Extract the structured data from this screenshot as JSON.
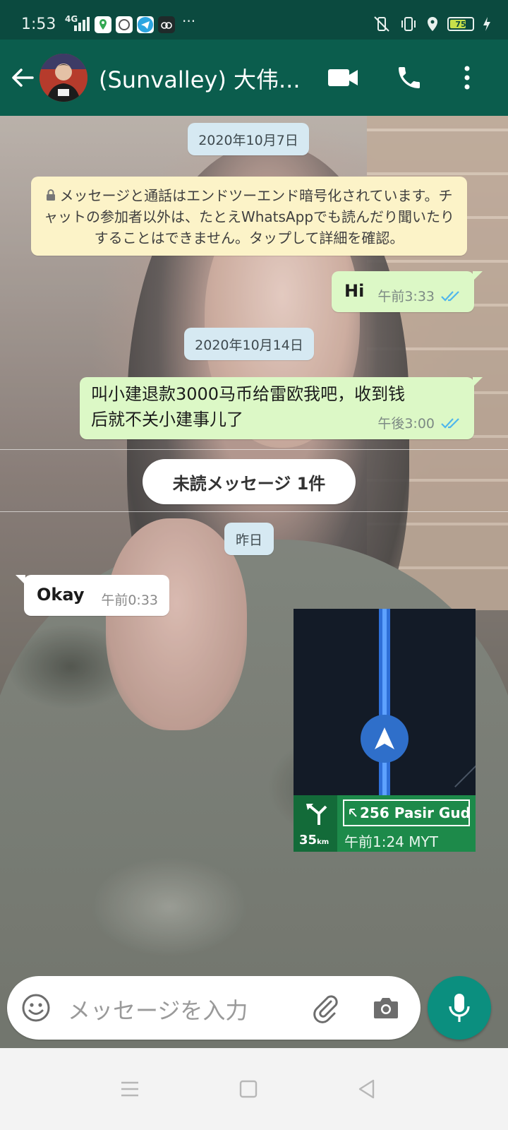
{
  "status_bar": {
    "time": "1:53",
    "network": "4G",
    "overflow": "···",
    "battery_level": "75",
    "battery_fraction": 0.75,
    "icons": [
      "signal-icon",
      "maps-app-icon",
      "app-icon",
      "telegram-icon",
      "cloud-app-icon",
      "vibrate-icon",
      "nfc-icon",
      "location-icon",
      "battery-icon",
      "charging-icon"
    ]
  },
  "header": {
    "chat_name": "(Sunvalley) 大伟...",
    "icons": [
      "back-arrow-icon",
      "video-call-icon",
      "phone-call-icon",
      "more-options-icon"
    ]
  },
  "chat": {
    "date_1": "2020年10月7日",
    "encryption_notice": "メッセージと通話はエンドツーエンド暗号化されています。チャットの参加者以外は、たとえWhatsAppでも読んだり聞いたりすることはできません。タップして詳細を確認。",
    "msg_1": {
      "text": "Hi",
      "time": "午前3:33",
      "status": "read"
    },
    "date_2": "2020年10月14日",
    "msg_2": {
      "line1": "叫小建退款3000马币给雷欧我吧，收到钱",
      "line2": "后就不关小建事儿了",
      "time": "午後3:00",
      "status": "read"
    },
    "unread_banner": "未読メッセージ 1件",
    "date_3": "昨日",
    "msg_3": {
      "text": "Okay",
      "time": "午前0:33"
    },
    "image_msg": {
      "distance": "35",
      "distance_unit": "km",
      "street": "256 Pasir Gud...",
      "eta": "午前1:24 MYT"
    }
  },
  "input": {
    "placeholder": "メッセージを入力"
  },
  "colors": {
    "header": "#0b5d4d",
    "status_bar": "#0b4a3f",
    "outgoing_bubble": "#dcf8c6",
    "incoming_bubble": "#ffffff",
    "read_ticks": "#4fb6ec",
    "mic_button": "#0b8f7f"
  }
}
